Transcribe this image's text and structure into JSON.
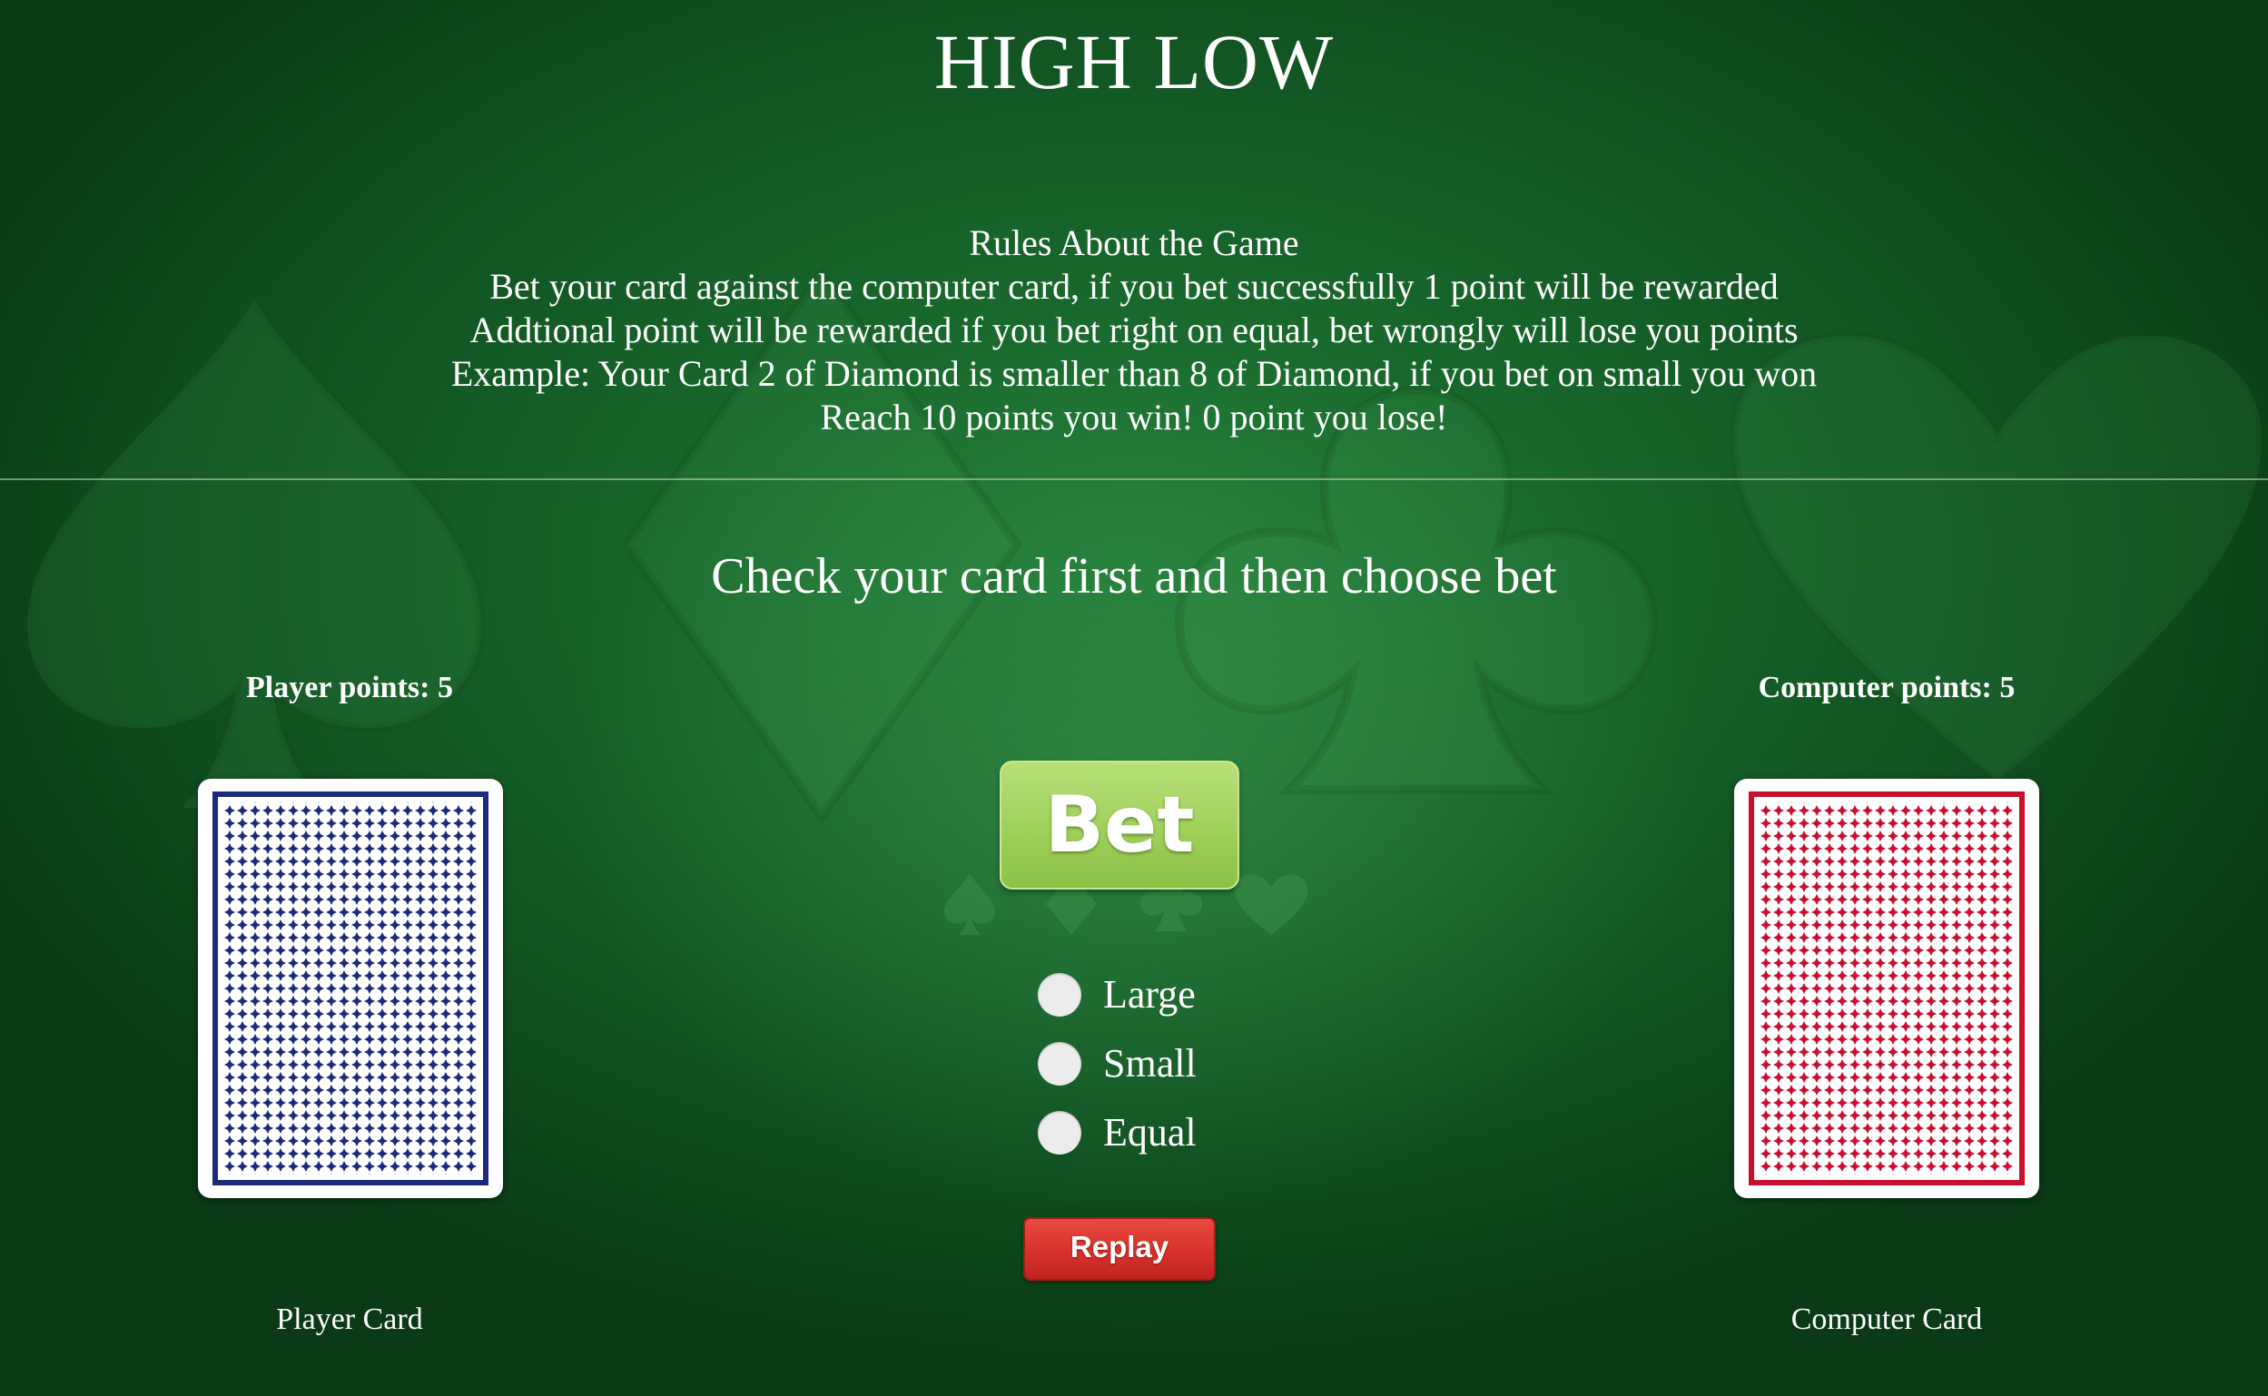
{
  "game": {
    "title": "HIGH LOW",
    "rules": [
      "Rules About the Game",
      "Bet your card against the computer card, if you bet successfully 1 point will be rewarded",
      "Addtional point will be rewarded if you bet right on equal, bet wrongly will lose you points",
      "Example: Your Card 2 of Diamond is smaller than 8 of Diamond, if you bet on small you won",
      "Reach 10 points you win! 0 point you lose!"
    ],
    "prompt": "Check your card first and then choose bet"
  },
  "player": {
    "points_label": "Player points: 5",
    "card_label": "Player Card",
    "card_back_color": "#1b2a7a"
  },
  "computer": {
    "points_label": "Computer points: 5",
    "card_label": "Computer Card",
    "card_back_color": "#c8102e"
  },
  "controls": {
    "bet_label": "Bet",
    "options": [
      "Large",
      "Small",
      "Equal"
    ],
    "replay_label": "Replay"
  },
  "colors": {
    "table_green": "#166128",
    "bet_green": "#9fd05a",
    "replay_red": "#d6322b"
  }
}
